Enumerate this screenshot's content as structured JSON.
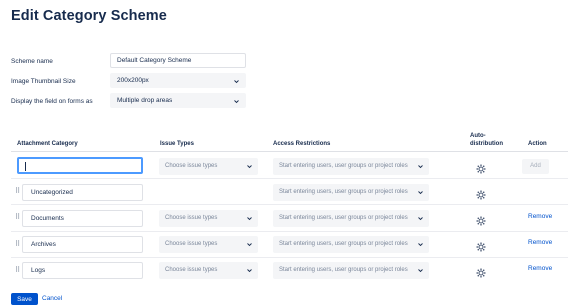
{
  "page": {
    "title": "Edit Category Scheme"
  },
  "form": {
    "scheme_name": {
      "label": "Scheme name",
      "value": "Default Category Scheme"
    },
    "thumbnail": {
      "label": "Image Thumbnail Size",
      "value": "200x200px"
    },
    "display": {
      "label": "Display the field on forms as",
      "value": "Multiple drop areas"
    }
  },
  "table": {
    "headers": {
      "category": "Attachment Category",
      "issue_types": "Issue Types",
      "access": "Access Restrictions",
      "auto1": "Auto-",
      "auto2": "distribution",
      "action": "Action"
    },
    "new_row": {
      "category_value": "",
      "issue_placeholder": "Choose issue types",
      "access_placeholder": "Start entering users, user groups or project roles",
      "add_label": "Add"
    },
    "rows": [
      {
        "category": "Uncategorized",
        "issue_placeholder": "",
        "access_placeholder": "Start entering users, user groups or project roles",
        "action": ""
      },
      {
        "category": "Documents",
        "issue_placeholder": "Choose issue types",
        "access_placeholder": "Start entering users, user groups or project roles",
        "action": "Remove"
      },
      {
        "category": "Archives",
        "issue_placeholder": "Choose issue types",
        "access_placeholder": "Start entering users, user groups or project roles",
        "action": "Remove"
      },
      {
        "category": "Logs",
        "issue_placeholder": "Choose issue types",
        "access_placeholder": "Start entering users, user groups or project roles",
        "action": "Remove"
      }
    ]
  },
  "buttons": {
    "save": "Save",
    "cancel": "Cancel"
  },
  "icons": {
    "drag": "drag-handle-icon",
    "gear": "gear-icon",
    "chevron": "chevron-down-icon"
  },
  "colors": {
    "primary": "#0052cc",
    "focus": "#4c9aff",
    "muted": "#7a869a",
    "border": "#dfe1e6"
  }
}
